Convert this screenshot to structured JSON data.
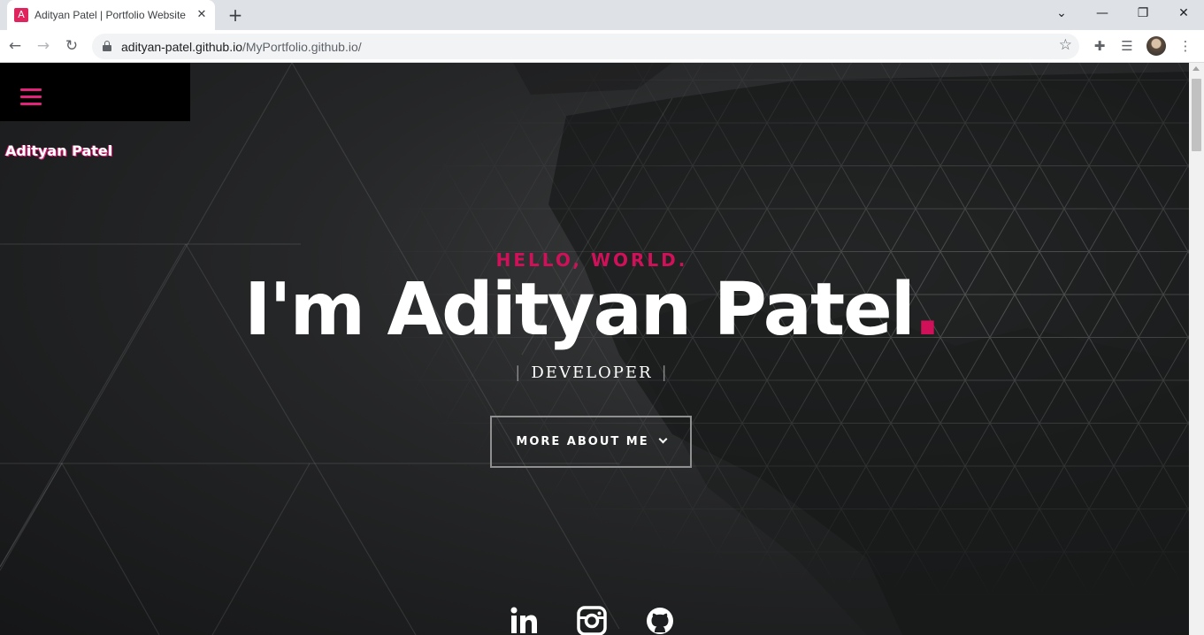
{
  "browser": {
    "tab_title": "Adityan Patel | Portfolio Website",
    "tab_favicon_letter": "A",
    "tab_close": "✕",
    "new_tab": "+",
    "url_domain": "adityan-patel.github.io",
    "url_path": "/MyPortfolio.github.io/",
    "window_controls": {
      "menu": "⌄",
      "minimize": "—",
      "maximize": "❐",
      "close": "✕"
    }
  },
  "site": {
    "name": "Adityan Patel",
    "greeting": "HELLO, WORLD.",
    "headline": "I'm Adityan Patel",
    "headline_dot": ".",
    "role_bar_left": "|",
    "role": "DEVELOPER",
    "role_bar_right": "|",
    "more_button_label": "MORE ABOUT ME"
  },
  "social_icons": [
    "linkedin-icon",
    "instagram-icon",
    "github-icon"
  ],
  "colors": {
    "accent": "#d1105a",
    "menu_accent": "#e0247a",
    "page_background": "#262728",
    "menu_background": "#000000"
  }
}
